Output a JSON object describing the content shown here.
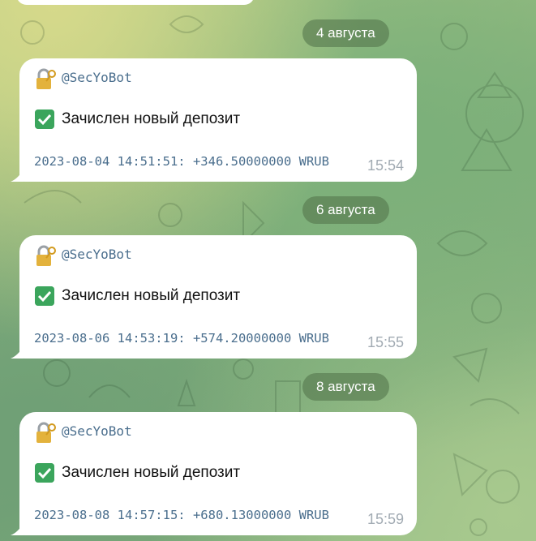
{
  "colors": {
    "bubble": "#ffffff",
    "sender": "#4a6e8d",
    "time": "#a2abb3",
    "date_pill_bg": "rgba(86,120,78,0.62)",
    "check": "#3ba55c"
  },
  "date_separators": [
    {
      "label": "4 августа"
    },
    {
      "label": "6 августа"
    },
    {
      "label": "8 августа"
    }
  ],
  "messages": [
    {
      "sender": "@SecYoBot",
      "sender_icon": "lock-with-key-icon",
      "status_icon": "check-mark-icon",
      "text": "Зачислен новый депозит",
      "details": "2023-08-04 14:51:51: +346.50000000 WRUB",
      "time": "15:54"
    },
    {
      "sender": "@SecYoBot",
      "sender_icon": "lock-with-key-icon",
      "status_icon": "check-mark-icon",
      "text": "Зачислен новый депозит",
      "details": "2023-08-06 14:53:19: +574.20000000 WRUB",
      "time": "15:55"
    },
    {
      "sender": "@SecYoBot",
      "sender_icon": "lock-with-key-icon",
      "status_icon": "check-mark-icon",
      "text": "Зачислен новый депозит",
      "details": "2023-08-08 14:57:15: +680.13000000 WRUB",
      "time": "15:59"
    }
  ]
}
